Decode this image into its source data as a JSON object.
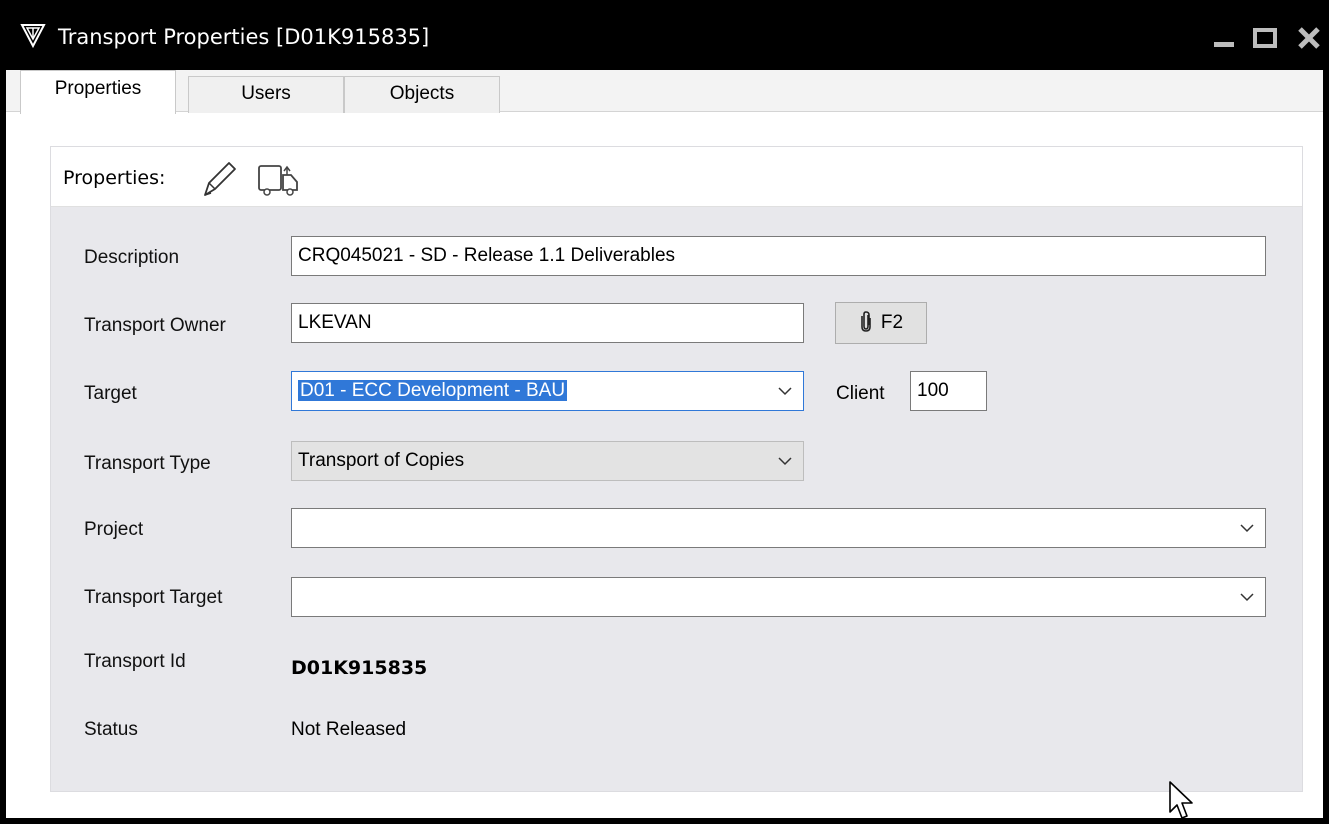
{
  "window": {
    "title": "Transport Properties [D01K915835]",
    "controls": [
      "minimize-icon",
      "maximize-icon",
      "close-icon"
    ]
  },
  "tabs": [
    {
      "label": "Properties",
      "active": true
    },
    {
      "label": "Users",
      "active": false
    },
    {
      "label": "Objects",
      "active": false
    }
  ],
  "panel": {
    "header_label": "Properties:",
    "header_icons": [
      "pencil-icon",
      "truck-icon"
    ]
  },
  "form": {
    "description": {
      "label": "Description",
      "value": "CRQ045021 - SD - Release 1.1 Deliverables"
    },
    "owner": {
      "label": "Transport Owner",
      "value": "LKEVAN",
      "button_label": "F2"
    },
    "target": {
      "label": "Target",
      "value": "D01 - ECC Development - BAU"
    },
    "client": {
      "label": "Client",
      "value": "100"
    },
    "transport_type": {
      "label": "Transport Type",
      "value": "Transport of Copies"
    },
    "project": {
      "label": "Project",
      "value": ""
    },
    "transport_target": {
      "label": "Transport Target",
      "value": ""
    },
    "transport_id": {
      "label": "Transport Id",
      "value": "D01K915835"
    },
    "status": {
      "label": "Status",
      "value": "Not Released"
    }
  },
  "colors": {
    "titlebar": "#000000",
    "panel_bg": "#e8e8ec",
    "selection": "#3078d8"
  }
}
